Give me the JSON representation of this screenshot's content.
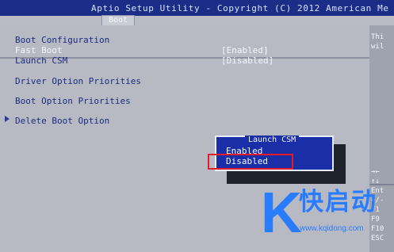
{
  "app": {
    "title": "Aptio Setup Utility - Copyright (C) 2012 American Me",
    "active_tab": "Boot"
  },
  "boot_menu": {
    "section_title": "Boot Configuration",
    "fast_boot_label": "Fast Boot",
    "fast_boot_value": "[Enabled]",
    "launch_csm_label": "Launch CSM",
    "launch_csm_value": "[Disabled]",
    "driver_option_priorities": "Driver Option Priorities",
    "boot_option_priorities": "Boot Option Priorities",
    "delete_boot_option": "Delete Boot Option"
  },
  "popup": {
    "title": "Launch CSM",
    "options": [
      "Enabled",
      "Disabled"
    ],
    "selected": "Disabled",
    "highlight_color": "#e11d2a"
  },
  "help_panel": {
    "lines": [
      "Thi",
      "wil",
      "→←",
      "↑↓",
      "Ent",
      "+/-",
      "F1",
      "F9",
      "F10",
      "ESC"
    ]
  },
  "watermark": {
    "logo_letter": "K",
    "brand_text": "快启动",
    "url": "www.kqidong.com",
    "color": "#2a7cff"
  }
}
